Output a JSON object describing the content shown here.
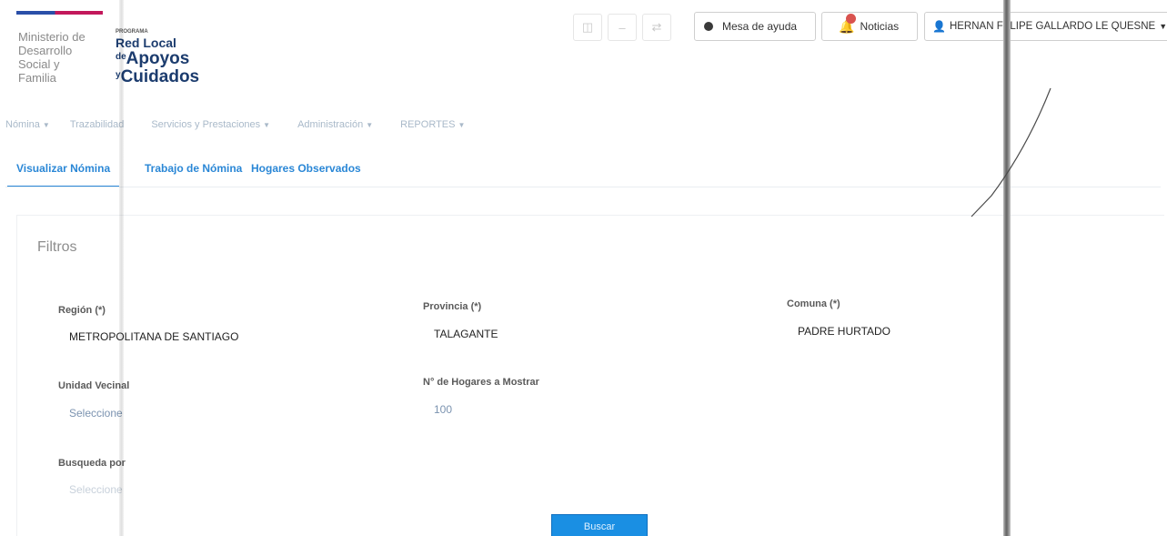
{
  "header": {
    "ministry": [
      "Ministerio de",
      "Desarrollo",
      "Social y",
      "Familia"
    ],
    "brand": {
      "pre": "PROGRAMA",
      "line1": "Red Local",
      "line2_prefix": "de",
      "line2": "Apoyos",
      "line3_prefix": "y",
      "line3": "Cuidados"
    },
    "buttons": {
      "help": "Mesa de ayuda",
      "news": "Noticias",
      "user": "HERNAN FELIPE GALLARDO LE QUESNE"
    }
  },
  "nav": [
    {
      "label": "Nómina",
      "caret": true
    },
    {
      "label": "Trazabilidad",
      "caret": false
    },
    {
      "label": "Servicios y Prestaciones",
      "caret": true
    },
    {
      "label": "Administración",
      "caret": true
    },
    {
      "label": "REPORTES",
      "caret": true
    }
  ],
  "subtabs": [
    "Visualizar Nómina",
    "Trabajo de Nómina",
    "Hogares Observados"
  ],
  "filters": {
    "title": "Filtros",
    "region": {
      "label": "Región (*)",
      "value": "METROPOLITANA DE SANTIAGO"
    },
    "provincia": {
      "label": "Provincia (*)",
      "value": "TALAGANTE"
    },
    "comuna": {
      "label": "Comuna (*)",
      "value": "PADRE HURTADO"
    },
    "unidad_vecinal": {
      "label": "Unidad Vecinal",
      "value": "Seleccione"
    },
    "num_hogares": {
      "label": "N° de Hogares a Mostrar",
      "value": "100"
    },
    "busqueda": {
      "label": "Busqueda por",
      "value": "Seleccione"
    },
    "search_button": "Buscar"
  }
}
